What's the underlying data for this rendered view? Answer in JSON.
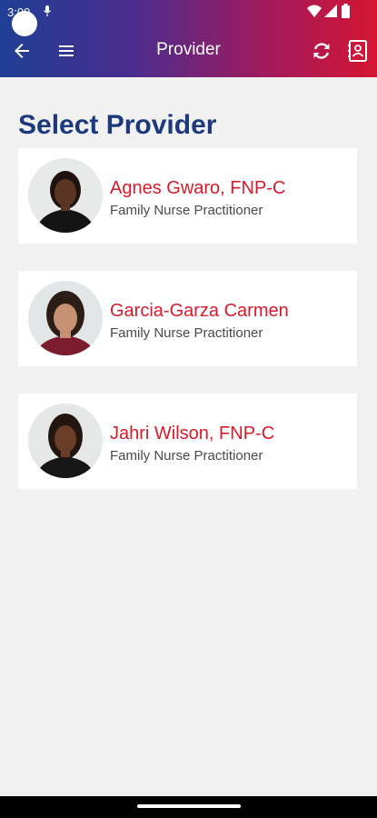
{
  "status_bar": {
    "time": "3:09"
  },
  "app_bar": {
    "title": "Provider"
  },
  "page": {
    "heading": "Select Provider"
  },
  "providers": [
    {
      "name": "Agnes Gwaro, FNP-C",
      "role": "Family Nurse Practitioner"
    },
    {
      "name": "Garcia-Garza Carmen",
      "role": "Family Nurse Practitioner"
    },
    {
      "name": "Jahri Wilson, FNP-C",
      "role": "Family Nurse Practitioner"
    }
  ],
  "colors": {
    "header_gradient": [
      "#1f3f94",
      "#d41532"
    ],
    "heading": "#1c3a7b",
    "provider_name": "#d81a2a",
    "background": "#f1f1f2"
  },
  "icons": [
    "back-arrow-icon",
    "menu-icon",
    "refresh-icon",
    "contact-card-icon"
  ]
}
